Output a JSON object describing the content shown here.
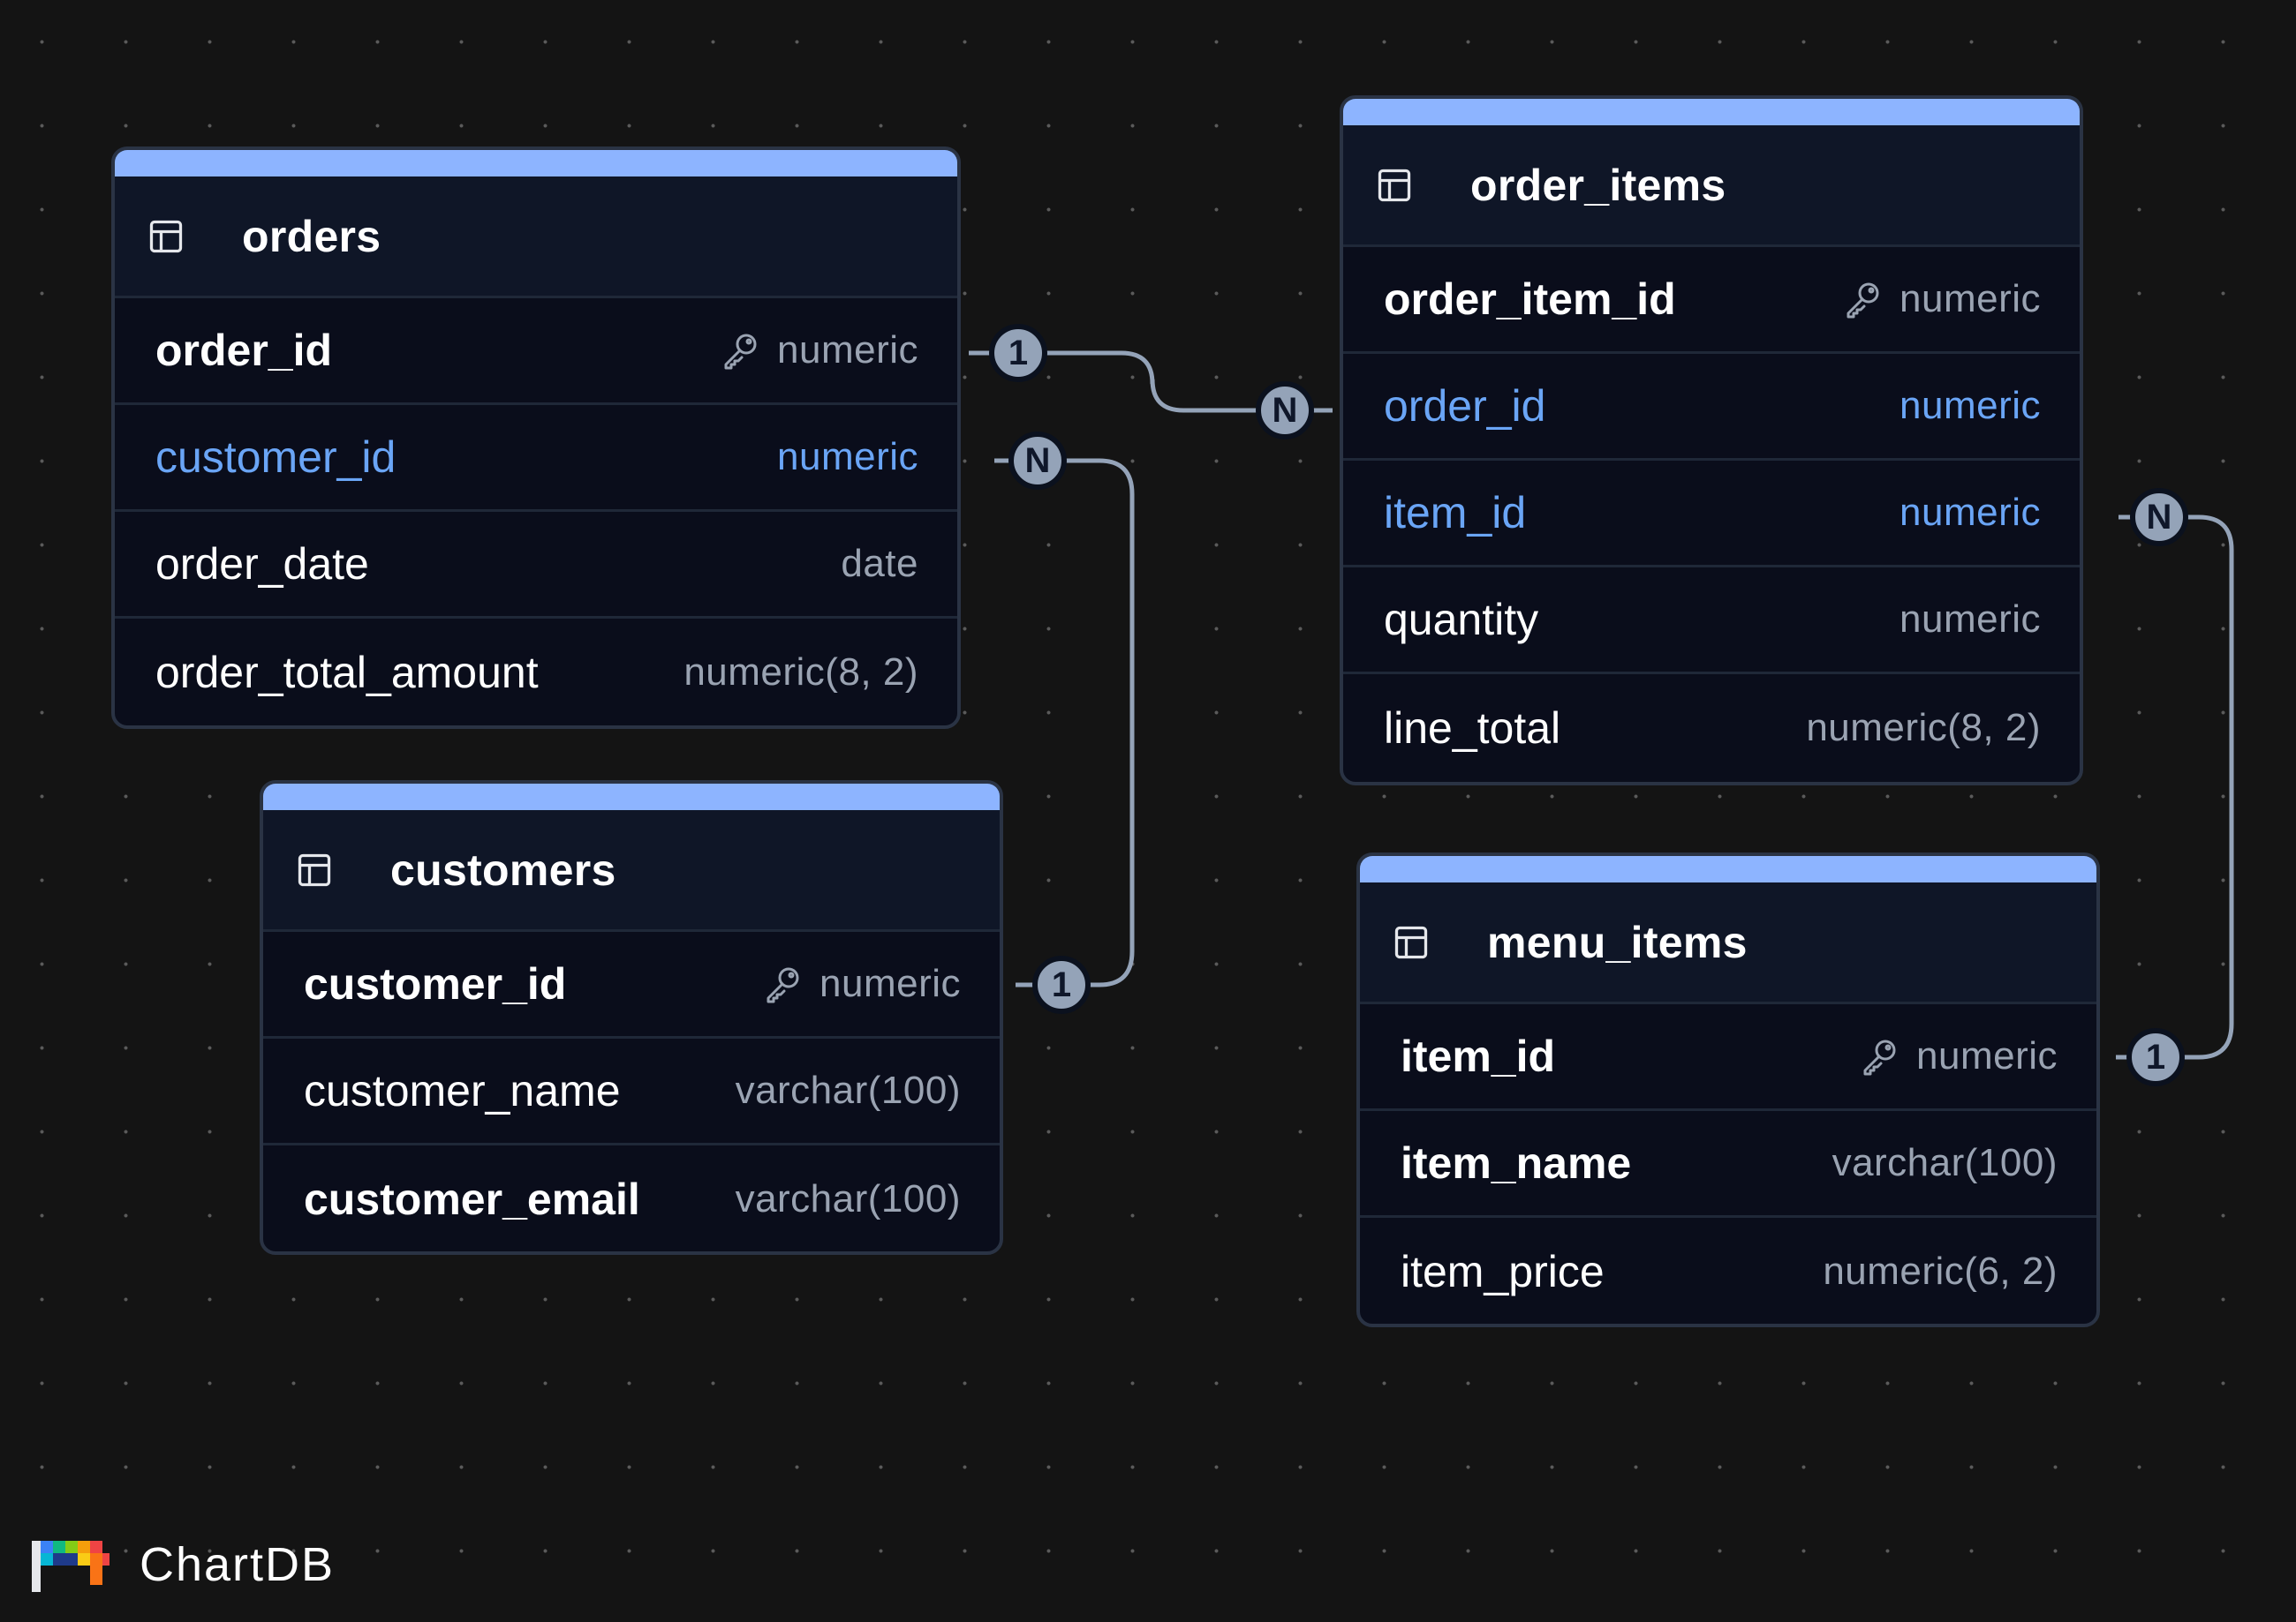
{
  "tables": [
    {
      "id": "orders",
      "name": "orders",
      "icon": "table-icon",
      "fields": [
        {
          "name": "order_id",
          "type": "numeric",
          "primary_key": true,
          "foreign_key": false,
          "bold": true
        },
        {
          "name": "customer_id",
          "type": "numeric",
          "primary_key": false,
          "foreign_key": true,
          "bold": false
        },
        {
          "name": "order_date",
          "type": "date",
          "primary_key": false,
          "foreign_key": false,
          "bold": false
        },
        {
          "name": "order_total_amount",
          "type": "numeric(8, 2)",
          "primary_key": false,
          "foreign_key": false,
          "bold": false
        }
      ]
    },
    {
      "id": "customers",
      "name": "customers",
      "icon": "table-icon",
      "fields": [
        {
          "name": "customer_id",
          "type": "numeric",
          "primary_key": true,
          "foreign_key": false,
          "bold": true
        },
        {
          "name": "customer_name",
          "type": "varchar(100)",
          "primary_key": false,
          "foreign_key": false,
          "bold": false
        },
        {
          "name": "customer_email",
          "type": "varchar(100)",
          "primary_key": false,
          "foreign_key": false,
          "bold": true
        }
      ]
    },
    {
      "id": "order_items",
      "name": "order_items",
      "icon": "table-icon",
      "fields": [
        {
          "name": "order_item_id",
          "type": "numeric",
          "primary_key": true,
          "foreign_key": false,
          "bold": true
        },
        {
          "name": "order_id",
          "type": "numeric",
          "primary_key": false,
          "foreign_key": true,
          "bold": false
        },
        {
          "name": "item_id",
          "type": "numeric",
          "primary_key": false,
          "foreign_key": true,
          "bold": false
        },
        {
          "name": "quantity",
          "type": "numeric",
          "primary_key": false,
          "foreign_key": false,
          "bold": false
        },
        {
          "name": "line_total",
          "type": "numeric(8, 2)",
          "primary_key": false,
          "foreign_key": false,
          "bold": false
        }
      ]
    },
    {
      "id": "menu_items",
      "name": "menu_items",
      "icon": "table-icon",
      "fields": [
        {
          "name": "item_id",
          "type": "numeric",
          "primary_key": true,
          "foreign_key": false,
          "bold": true
        },
        {
          "name": "item_name",
          "type": "varchar(100)",
          "primary_key": false,
          "foreign_key": false,
          "bold": true
        },
        {
          "name": "item_price",
          "type": "numeric(6, 2)",
          "primary_key": false,
          "foreign_key": false,
          "bold": false
        }
      ]
    }
  ],
  "relationships": [
    {
      "from_table": "orders",
      "from_field": "order_id",
      "from_cardinality": "1",
      "to_table": "order_items",
      "to_field": "order_id",
      "to_cardinality": "N"
    },
    {
      "from_table": "orders",
      "from_field": "customer_id",
      "from_cardinality": "N",
      "to_table": "customers",
      "to_field": "customer_id",
      "to_cardinality": "1"
    },
    {
      "from_table": "order_items",
      "from_field": "item_id",
      "from_cardinality": "N",
      "to_table": "menu_items",
      "to_field": "item_id",
      "to_cardinality": "1"
    }
  ],
  "brand": {
    "name": "ChartDB",
    "icon": "chartdb-logo"
  },
  "colors": {
    "canvas_background": "#141414",
    "table_header_accent": "#8db4ff",
    "foreign_key_text": "#6aa5f6",
    "type_text": "#9aa3b2",
    "edge": "#94a3b8",
    "badge": "#94a3b8"
  }
}
